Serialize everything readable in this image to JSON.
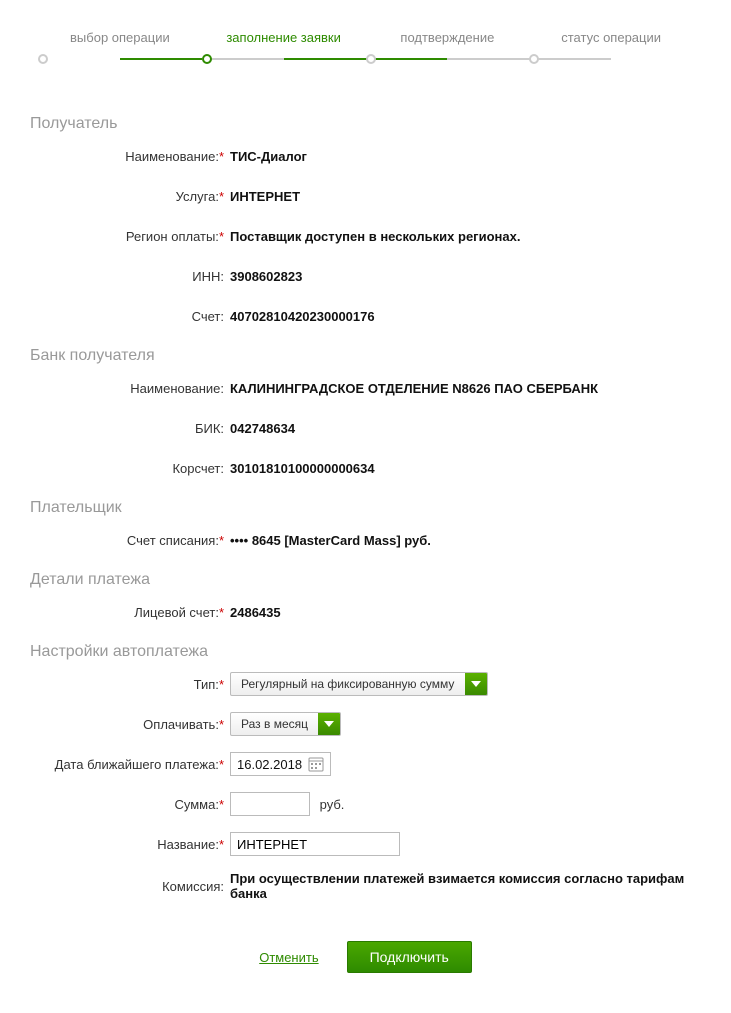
{
  "steps": {
    "s1": "выбор операции",
    "s2": "заполнение заявки",
    "s3": "подтверждение",
    "s4": "статус операции"
  },
  "sections": {
    "recipient": "Получатель",
    "bank": "Банк получателя",
    "payer": "Плательщик",
    "details": "Детали платежа",
    "autopay": "Настройки автоплатежа"
  },
  "labels": {
    "name": "Наименование:",
    "service": "Услуга:",
    "region": "Регион оплаты:",
    "inn": "ИНН:",
    "account": "Счет:",
    "bik": "БИК:",
    "corr": "Корсчет:",
    "debit_account": "Счет списания:",
    "personal_account": "Лицевой счет:",
    "type": "Тип:",
    "pay_freq": "Оплачивать:",
    "next_date": "Дата ближайшего платежа:",
    "sum": "Сумма:",
    "title": "Название:",
    "commission": "Комиссия:"
  },
  "values": {
    "recipient_name": "ТИС-Диалог",
    "service": "ИНТЕРНЕТ",
    "region": "Поставщик доступен в нескольких регионах.",
    "inn": "3908602823",
    "account": "40702810420230000176",
    "bank_name": "КАЛИНИНГРАДСКОЕ ОТДЕЛЕНИЕ N8626 ПАО СБЕРБАНК",
    "bik": "042748634",
    "corr": "30101810100000000634",
    "debit_account": "•••• 8645  [MasterCard Mass]  руб.",
    "personal_account": "2486435",
    "type_select": "Регулярный на фиксированную сумму",
    "freq_select": "Раз в месяц",
    "next_date": "16.02.2018",
    "sum_unit": "руб.",
    "title_input": "ИНТЕРНЕТ",
    "commission": "При осуществлении платежей взимается комиссия согласно тарифам банка"
  },
  "actions": {
    "cancel": "Отменить",
    "submit": "Подключить"
  }
}
